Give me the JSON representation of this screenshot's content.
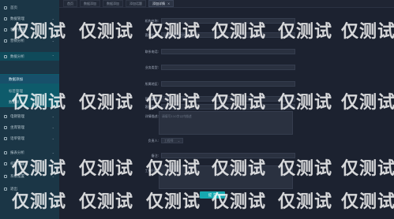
{
  "sidebar": {
    "items": [
      {
        "label": "首页",
        "icon": "home-icon"
      },
      {
        "label": "数据管理",
        "icon": "database-icon"
      },
      {
        "label": "客户管理",
        "icon": "user-icon"
      },
      {
        "label": "营销分析",
        "icon": "chart-icon"
      },
      {
        "label": "数据分析",
        "icon": "analysis-icon"
      },
      {
        "label": "数据添加",
        "icon": "add-icon"
      },
      {
        "label": "标签管理",
        "icon": "tag-icon"
      },
      {
        "label": "数据导入",
        "icon": "import-icon"
      },
      {
        "label": "电销管理",
        "icon": "phone-icon"
      },
      {
        "label": "坐席管理",
        "icon": "seat-icon"
      },
      {
        "label": "话单管理",
        "icon": "record-icon"
      },
      {
        "label": "报表分析",
        "icon": "report-icon"
      },
      {
        "label": "权限管理",
        "icon": "lock-icon"
      },
      {
        "label": "系统设置",
        "icon": "gear-icon"
      },
      {
        "label": "退出",
        "icon": "logout-icon"
      }
    ]
  },
  "tabs": [
    {
      "label": "首页"
    },
    {
      "label": "数据添加"
    },
    {
      "label": "数据添加"
    },
    {
      "label": "添加话题"
    },
    {
      "label": "添加详情"
    }
  ],
  "form": {
    "fields": [
      {
        "label": "机构名称:",
        "placeholder": ""
      },
      {
        "label": "客户标题:",
        "placeholder": "请输入客户名称"
      },
      {
        "label": "联系电话:",
        "placeholder": ""
      },
      {
        "label": "业务类型:",
        "placeholder": ""
      },
      {
        "label": "所属地区:",
        "placeholder": ""
      },
      {
        "label": "营销渠道:",
        "placeholder": ""
      },
      {
        "label": "客户等级:",
        "placeholder": ""
      }
    ],
    "desc_label": "详情描述:",
    "desc_placeholder": "请填写110字以内描述",
    "assignee_label": "负责人:",
    "assignee_value": "工程师",
    "note_label": "备注:",
    "remark_label": "工单归档:",
    "submit_label": "提 交"
  },
  "watermark": "仅测试"
}
